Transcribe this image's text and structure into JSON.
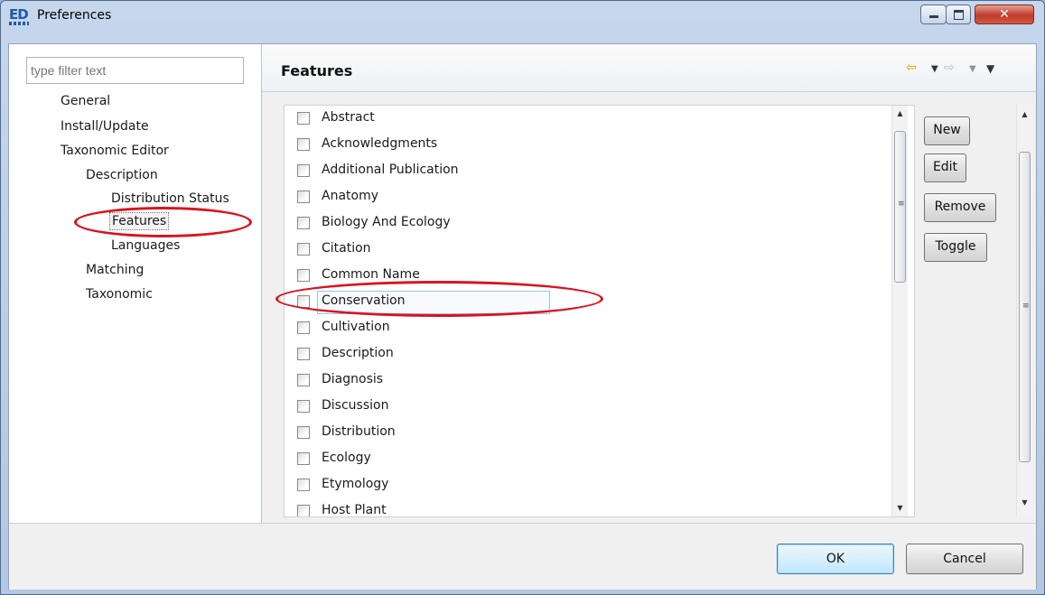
{
  "window": {
    "title": "Preferences",
    "app_icon": "ED"
  },
  "filter": {
    "placeholder": "type filter text"
  },
  "tree": [
    {
      "label": "General"
    },
    {
      "label": "Install/Update"
    },
    {
      "label": "Taxonomic Editor"
    },
    {
      "label": "Description"
    },
    {
      "label": "Distribution Status"
    },
    {
      "label": "Features",
      "selected": true
    },
    {
      "label": "Languages"
    },
    {
      "label": "Matching"
    },
    {
      "label": "Taxonomic"
    }
  ],
  "page": {
    "title": "Features",
    "nav": {
      "back_icon": "back-arrow-icon",
      "forward_icon": "forward-arrow-icon",
      "menu_icon": "view-menu-icon"
    }
  },
  "features": [
    {
      "label": "Abstract",
      "checked": false
    },
    {
      "label": "Acknowledgments",
      "checked": false
    },
    {
      "label": "Additional Publication",
      "checked": false
    },
    {
      "label": "Anatomy",
      "checked": false
    },
    {
      "label": "Biology And Ecology",
      "checked": false
    },
    {
      "label": "Citation",
      "checked": false
    },
    {
      "label": "Common Name",
      "checked": false
    },
    {
      "label": "Conservation",
      "checked": false,
      "focused": true
    },
    {
      "label": "Cultivation",
      "checked": false
    },
    {
      "label": "Description",
      "checked": false
    },
    {
      "label": "Diagnosis",
      "checked": false
    },
    {
      "label": "Discussion",
      "checked": false
    },
    {
      "label": "Distribution",
      "checked": false
    },
    {
      "label": "Ecology",
      "checked": false
    },
    {
      "label": "Etymology",
      "checked": false
    },
    {
      "label": "Host Plant",
      "checked": false
    }
  ],
  "side_buttons": {
    "new": "New",
    "edit": "Edit",
    "remove": "Remove",
    "toggle": "Toggle"
  },
  "footer": {
    "ok": "OK",
    "cancel": "Cancel"
  },
  "colors": {
    "annotation": "#d8141f",
    "titlebar": "#c6d7ec"
  }
}
